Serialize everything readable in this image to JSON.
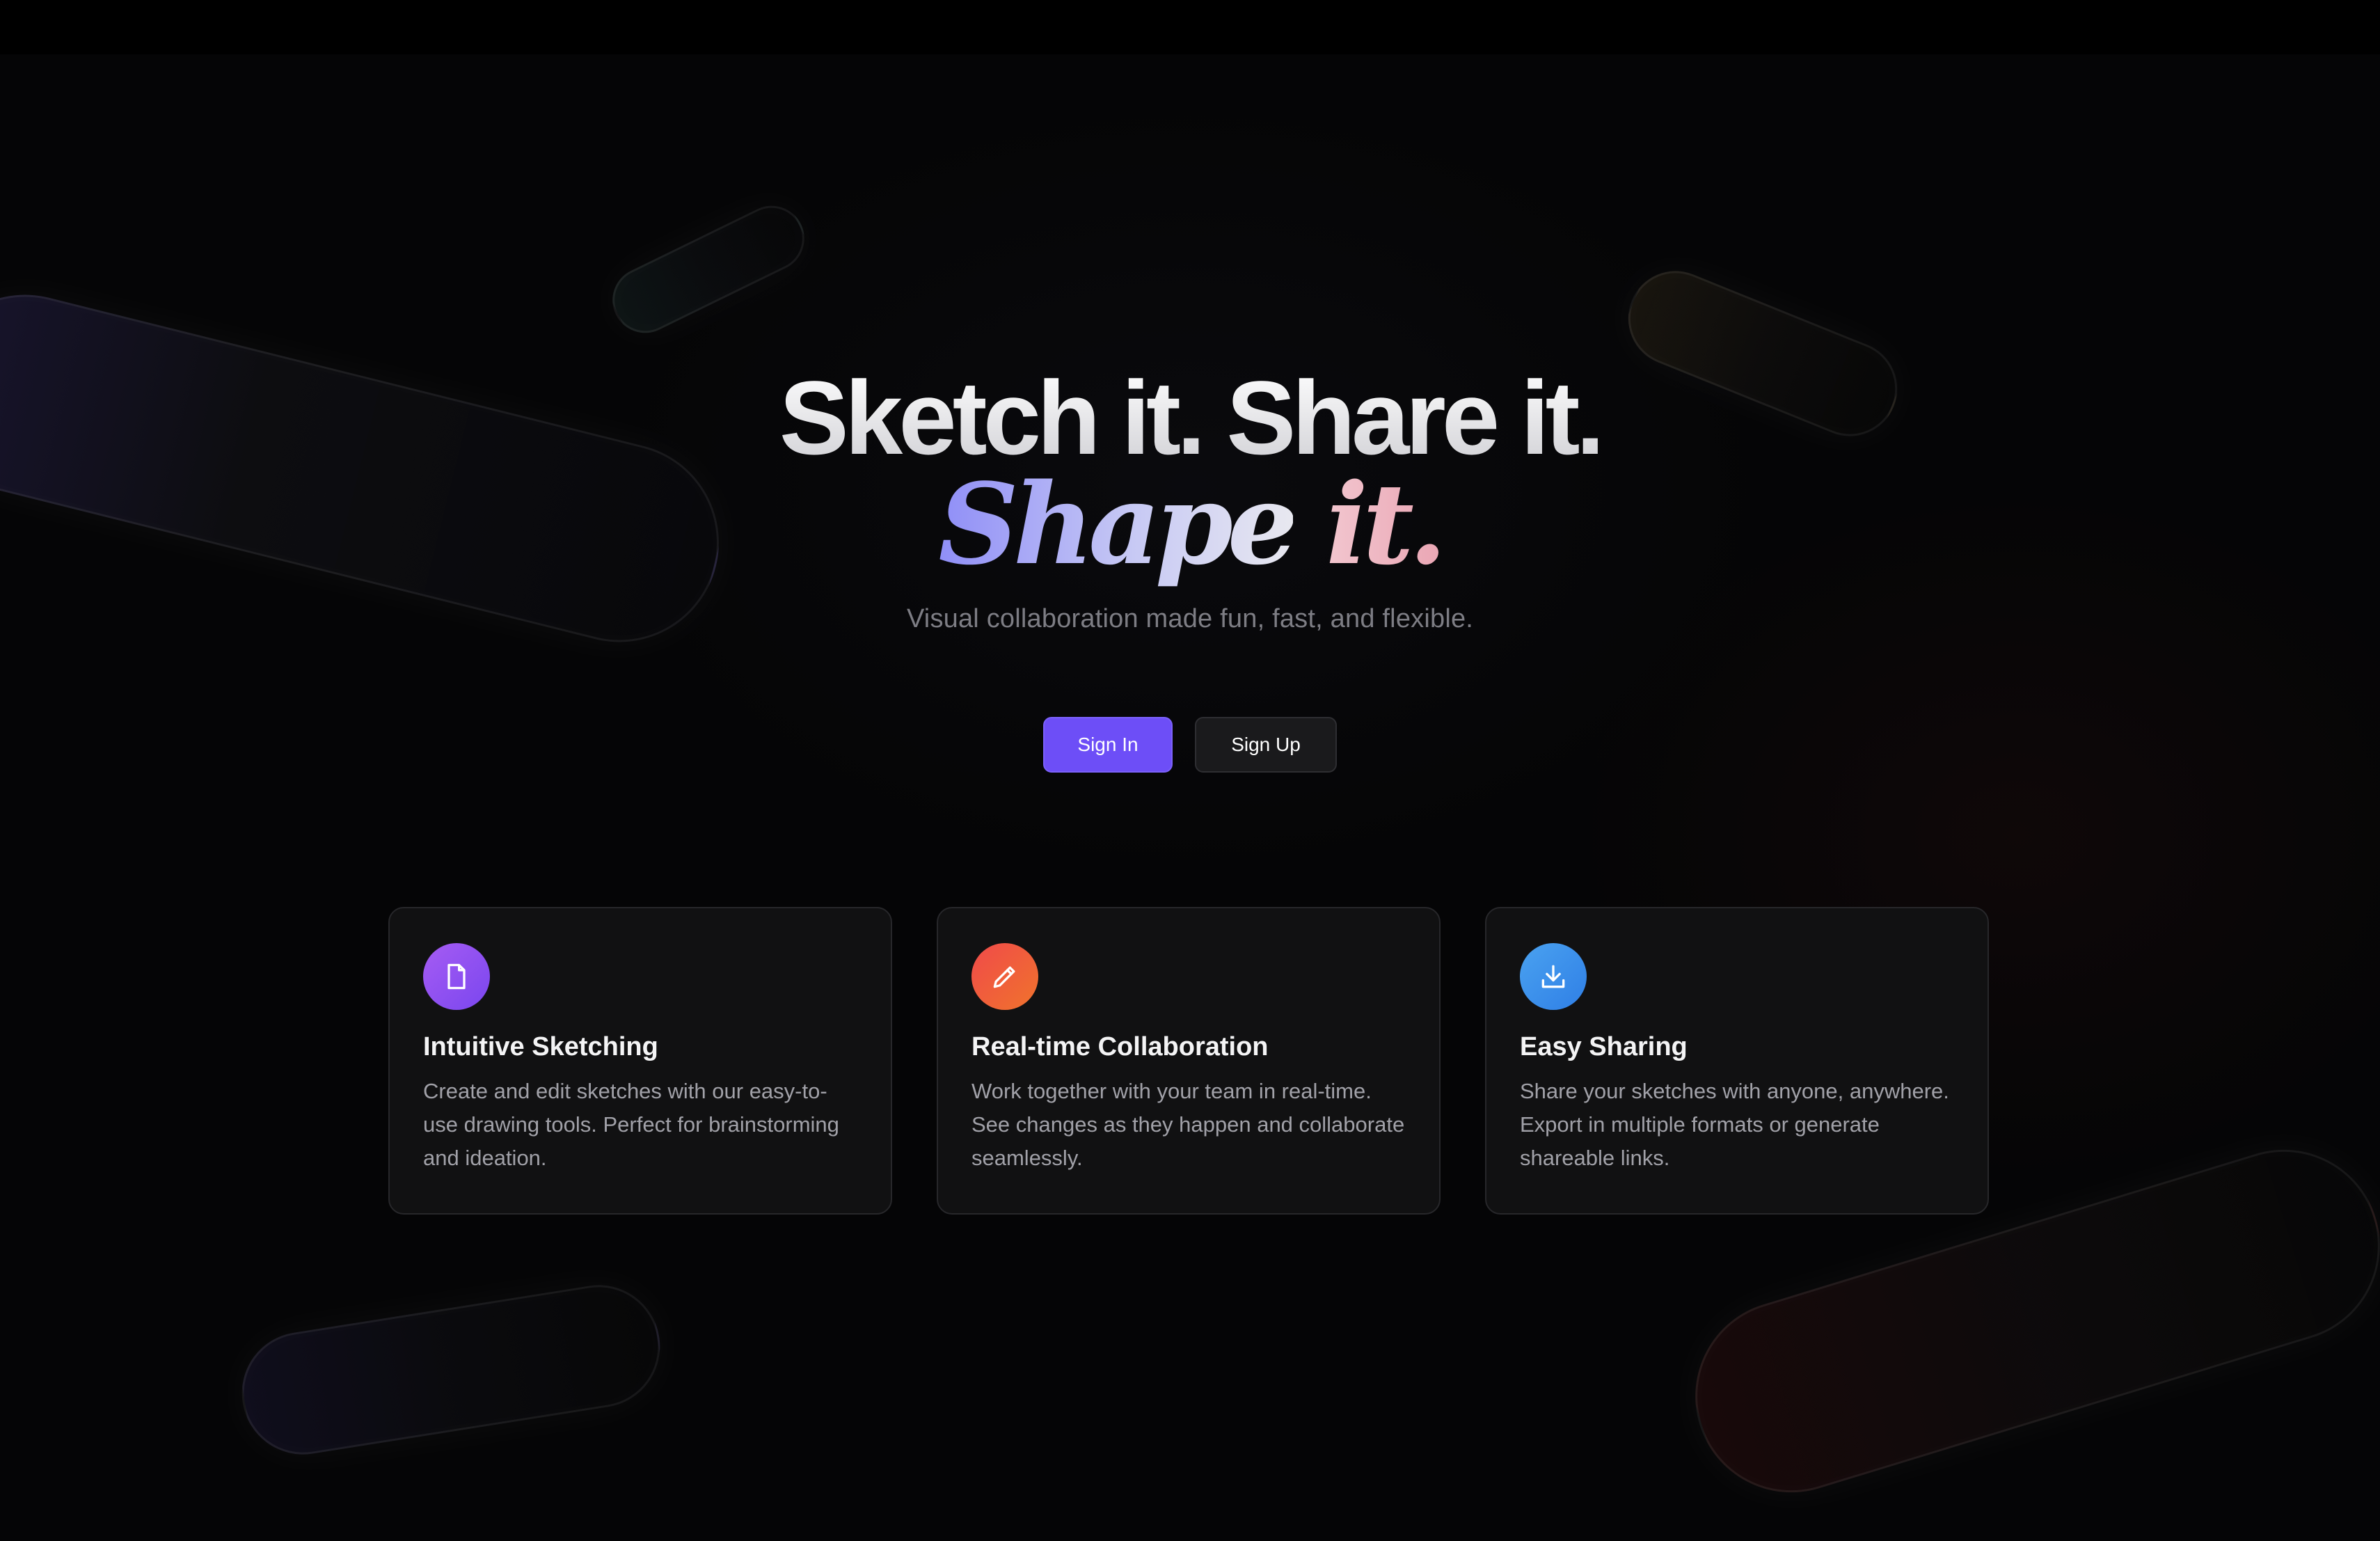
{
  "hero": {
    "headline": "Sketch it. Share it.",
    "script_word_1": "Shape",
    "script_word_2": "it.",
    "tagline": "Visual collaboration made fun, fast, and flexible."
  },
  "actions": {
    "sign_in_label": "Sign In",
    "sign_up_label": "Sign Up"
  },
  "features": [
    {
      "icon": "document-icon",
      "title": "Intuitive Sketching",
      "description": "Create and edit sketches with our easy-to-use drawing tools. Perfect for brainstorming and ideation."
    },
    {
      "icon": "pencil-icon",
      "title": "Real-time Collaboration",
      "description": "Work together with your team in real-time. See changes as they happen and collaborate seamlessly."
    },
    {
      "icon": "download-icon",
      "title": "Easy Sharing",
      "description": "Share your sketches with anyone, anywhere. Export in multiple formats or generate shareable links."
    }
  ],
  "colors": {
    "background": "#050506",
    "accent": "#6d4ef7",
    "card_background": "#111112",
    "icon_purple": "#8b50f1",
    "icon_red": "#f05a3a",
    "icon_blue": "#3b8fea"
  }
}
